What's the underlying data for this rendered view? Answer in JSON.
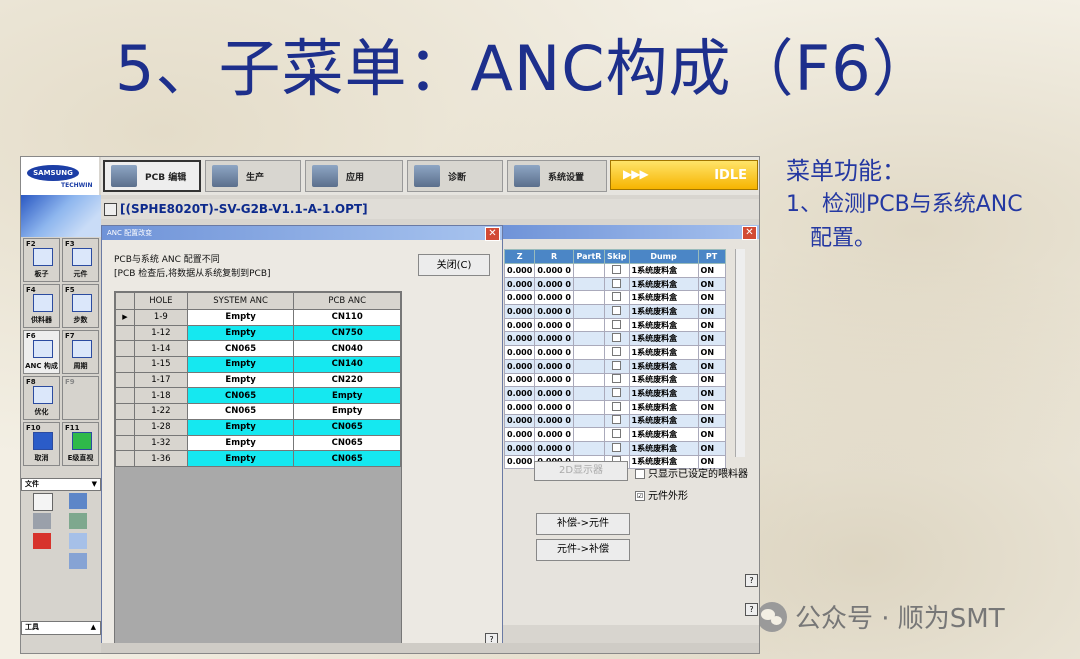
{
  "slide": {
    "title": "5、子菜单：ANC构成（F6）",
    "function_title": "菜单功能：",
    "function_item": "1、检测PCB与系统ANC配置。",
    "watermark": "公众号 · 顺为SMT"
  },
  "app": {
    "logo_brand": "SAMSUNG",
    "logo_sub": "TECHWIN",
    "top_tabs": [
      {
        "label": "PCB 编辑",
        "icon": "pcb-edit-icon"
      },
      {
        "label": "生产",
        "icon": "production-icon"
      },
      {
        "label": "应用",
        "icon": "application-icon"
      },
      {
        "label": "诊断",
        "icon": "diagnose-icon"
      },
      {
        "label": "系统设置",
        "icon": "system-settings-icon"
      }
    ],
    "status": "IDLE",
    "status_arrows": "▶▶▶",
    "file_title": "[(SPHE8020T)-SV-G2B-V1.1-A-1.OPT]",
    "fkeys": [
      {
        "key": "F2",
        "label": "板子"
      },
      {
        "key": "F3",
        "label": "元件"
      },
      {
        "key": "F4",
        "label": "供料器"
      },
      {
        "key": "F5",
        "label": "步数"
      },
      {
        "key": "F6",
        "label": "ANC 构成"
      },
      {
        "key": "F7",
        "label": "周期"
      },
      {
        "key": "F8",
        "label": "优化"
      },
      {
        "key": "F9",
        "label": ""
      },
      {
        "key": "F10",
        "label": "取消"
      },
      {
        "key": "F11",
        "label": "E级直视"
      }
    ],
    "file_menu": "文件",
    "tool_menu": "工具"
  },
  "dialog": {
    "title": "ANC 配置改变",
    "message1": "PCB与系统 ANC 配置不同",
    "message2": "[PCB 检查后,将数据从系统复制到PCB]",
    "close_button": "关闭(C)",
    "help": "?",
    "columns": [
      "HOLE",
      "SYSTEM ANC",
      "PCB ANC"
    ],
    "rows": [
      {
        "hole": "1-9",
        "system": "Empty",
        "pcb": "CN110",
        "sys_hl": false,
        "pcb_hl": false,
        "current": true
      },
      {
        "hole": "1-12",
        "system": "Empty",
        "pcb": "CN750",
        "sys_hl": true,
        "pcb_hl": true,
        "current": false
      },
      {
        "hole": "1-14",
        "system": "CN065",
        "pcb": "CN040",
        "sys_hl": false,
        "pcb_hl": false,
        "current": false
      },
      {
        "hole": "1-15",
        "system": "Empty",
        "pcb": "CN140",
        "sys_hl": true,
        "pcb_hl": true,
        "current": false
      },
      {
        "hole": "1-17",
        "system": "Empty",
        "pcb": "CN220",
        "sys_hl": false,
        "pcb_hl": false,
        "current": false
      },
      {
        "hole": "1-18",
        "system": "CN065",
        "pcb": "Empty",
        "sys_hl": true,
        "pcb_hl": true,
        "current": false
      },
      {
        "hole": "1-22",
        "system": "CN065",
        "pcb": "Empty",
        "sys_hl": false,
        "pcb_hl": false,
        "current": false
      },
      {
        "hole": "1-28",
        "system": "Empty",
        "pcb": "CN065",
        "sys_hl": true,
        "pcb_hl": true,
        "current": false
      },
      {
        "hole": "1-32",
        "system": "Empty",
        "pcb": "CN065",
        "sys_hl": false,
        "pcb_hl": false,
        "current": false
      },
      {
        "hole": "1-36",
        "system": "Empty",
        "pcb": "CN065",
        "sys_hl": true,
        "pcb_hl": true,
        "current": false
      }
    ]
  },
  "bgwin": {
    "columns": [
      "Z",
      "R",
      "PartR",
      "Skip",
      "Dump",
      "PT"
    ],
    "row": {
      "z": "0.000",
      "r": "0.000 0",
      "dump": "1系统废料盒",
      "pt": "ON"
    },
    "row_count": 15,
    "btn_display": "2D显示器",
    "opt_show_set": "只显示已设定的喂料器",
    "opt_outline": "元件外形",
    "opt_outline_mark": "☑",
    "btn_comp_to_comp": "补偿->元件",
    "btn_part_to_comp": "元件->补偿",
    "help": "?"
  }
}
